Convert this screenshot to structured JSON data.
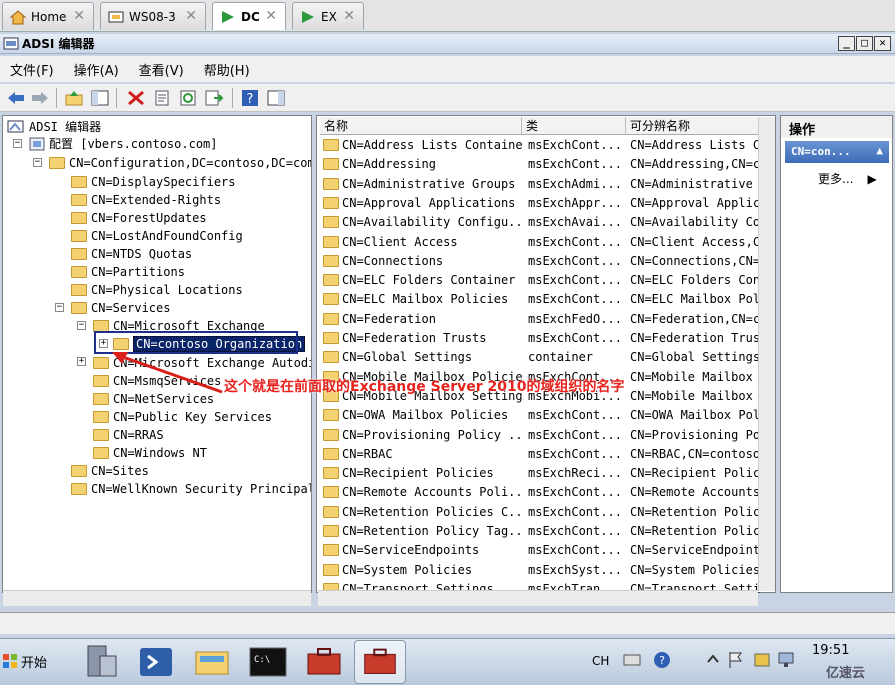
{
  "vm_tabs": [
    {
      "label": "Home",
      "icon": "home-icon"
    },
    {
      "label": "WS08-3",
      "icon": "vm-icon"
    },
    {
      "label": "DC",
      "icon": "vm-icon",
      "active": true
    },
    {
      "label": "EX",
      "icon": "vm-icon"
    }
  ],
  "window": {
    "title": "ADSI 编辑器"
  },
  "menu": [
    "文件(F)",
    "操作(A)",
    "查看(V)",
    "帮助(H)"
  ],
  "tree": {
    "root": "ADSI 编辑器",
    "config": "配置 [vbers.contoso.com]",
    "config_dn": "CN=Configuration,DC=contoso,DC=com",
    "children": [
      "CN=DisplaySpecifiers",
      "CN=Extended-Rights",
      "CN=ForestUpdates",
      "CN=LostAndFoundConfig",
      "CN=NTDS Quotas",
      "CN=Partitions",
      "CN=Physical Locations"
    ],
    "services": "CN=Services",
    "exchange": "CN=Microsoft Exchange",
    "org": "CN=contoso Organization",
    "services_children": [
      "CN=Microsoft Exchange Autodis",
      "CN=MsmqServices",
      "CN=NetServices",
      "CN=Public Key Services",
      "CN=RRAS",
      "CN=Windows NT"
    ],
    "tail": [
      "CN=Sites",
      "CN=WellKnown Security Principals"
    ]
  },
  "list": {
    "headers": [
      "名称",
      "类",
      "可分辨名称"
    ],
    "rows": [
      [
        "CN=Address Lists Container",
        "msExchCont...",
        "CN=Address Lists Co"
      ],
      [
        "CN=Addressing",
        "msExchCont...",
        "CN=Addressing,CN=co"
      ],
      [
        "CN=Administrative Groups",
        "msExchAdmi...",
        "CN=Administrative G"
      ],
      [
        "CN=Approval Applications",
        "msExchAppr...",
        "CN=Approval Applica"
      ],
      [
        "CN=Availability Configu...",
        "msExchAvai...",
        "CN=Availability Cor"
      ],
      [
        "CN=Client Access",
        "msExchCont...",
        "CN=Client Access,CN"
      ],
      [
        "CN=Connections",
        "msExchCont...",
        "CN=Connections,CN=c"
      ],
      [
        "CN=ELC Folders Container",
        "msExchCont...",
        "CN=ELC Folders Cont"
      ],
      [
        "CN=ELC Mailbox Policies",
        "msExchCont...",
        "CN=ELC Mailbox Poli"
      ],
      [
        "CN=Federation",
        "msExchFedO...",
        "CN=Federation,CN=co"
      ],
      [
        "CN=Federation Trusts",
        "msExchCont...",
        "CN=Federation Trust"
      ],
      [
        "CN=Global Settings",
        "container",
        "CN=Global Settings,"
      ],
      [
        "CN=Mobile Mailbox Policies",
        "msExchCont...",
        "CN=Mobile Mailbox P"
      ],
      [
        "CN=Mobile Mailbox Settings",
        "msExchMobi...",
        "CN=Mobile Mailbox S"
      ],
      [
        "CN=OWA Mailbox Policies",
        "msExchCont...",
        "CN=OWA Mailbox Poli"
      ],
      [
        "CN=Provisioning Policy ...",
        "msExchCont...",
        "CN=Provisioning Pol"
      ],
      [
        "CN=RBAC",
        "msExchCont...",
        "CN=RBAC,CN=contoso"
      ],
      [
        "CN=Recipient Policies",
        "msExchReci...",
        "CN=Recipient Polici"
      ],
      [
        "CN=Remote Accounts Poli...",
        "msExchCont...",
        "CN=Remote Accounts"
      ],
      [
        "CN=Retention Policies C...",
        "msExchCont...",
        "CN=Retention Polici"
      ],
      [
        "CN=Retention Policy Tag...",
        "msExchCont...",
        "CN=Retention Policy"
      ],
      [
        "CN=ServiceEndpoints",
        "msExchCont...",
        "CN=ServiceEndpoints"
      ],
      [
        "CN=System Policies",
        "msExchSyst...",
        "CN=System Policies,"
      ],
      [
        "CN=Transport Settings",
        "msExchTran...",
        "CN=Transport Settin"
      ]
    ]
  },
  "actions": {
    "header": "操作",
    "selected": "CN=con...",
    "more": "更多..."
  },
  "annotation": "这个就是在前面取的Exchange Server 2010的域组织的名字",
  "taskbar": {
    "start": "开始",
    "lang": "CH",
    "time": "19:51"
  },
  "watermark": "亿速云"
}
